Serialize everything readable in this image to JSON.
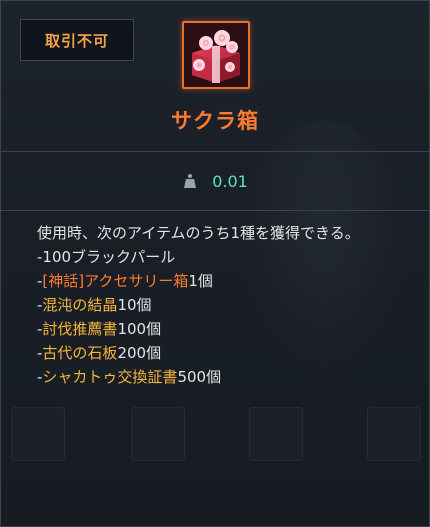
{
  "tooltip": {
    "badge": "取引不可",
    "item_name": "サクラ箱",
    "icon": "sakura-gift-box-icon",
    "weight_icon": "weight-icon",
    "weight": "0.01",
    "description_intro": "使用時、次のアイテムのうち1種を獲得できる。",
    "rewards": [
      {
        "prefix": "-",
        "name": "100ブラックパール",
        "suffix": ""
      },
      {
        "prefix": "-",
        "name": "[神話]アクセサリー箱",
        "suffix": "1個"
      },
      {
        "prefix": "-",
        "name": "混沌の結晶",
        "suffix": "10個"
      },
      {
        "prefix": "-",
        "name": "討伐推薦書",
        "suffix": "100個"
      },
      {
        "prefix": "-",
        "name": "古代の石板",
        "suffix": "200個"
      },
      {
        "prefix": "-",
        "name": "シャカトゥ交換証書",
        "suffix": "500個"
      }
    ]
  },
  "colors": {
    "badge_text": "#f2a24a",
    "item_name": "#ff7a2f",
    "weight": "#5ee0cc",
    "mythic": "#ff7a2f",
    "highlight": "#f5b53a"
  }
}
